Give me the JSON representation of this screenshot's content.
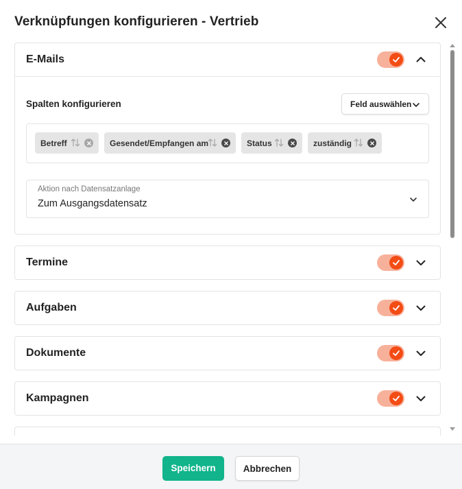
{
  "dialog": {
    "title": "Verknüpfungen konfigurieren - Vertrieb",
    "close_icon": "close-icon"
  },
  "colors": {
    "toggle_track": "#f7b19b",
    "toggle_knob": "#f34c14",
    "primary_button": "#12b48c",
    "footer_bg": "#f4f5f6"
  },
  "sections": [
    {
      "title": "E-Mails",
      "enabled": true,
      "expanded": true,
      "columns_label": "Spalten konfigurieren",
      "field_button_label": "Feld auswählen",
      "chips": [
        {
          "label": "Betreff"
        },
        {
          "label": "Gesendet/Empfangen am"
        },
        {
          "label": "Status"
        },
        {
          "label": "zuständig"
        }
      ],
      "action_label": "Aktion nach Datensatzanlage",
      "action_value": "Zum Ausgangsdatensatz"
    },
    {
      "title": "Termine",
      "enabled": true,
      "expanded": false
    },
    {
      "title": "Aufgaben",
      "enabled": true,
      "expanded": false
    },
    {
      "title": "Dokumente",
      "enabled": true,
      "expanded": false
    },
    {
      "title": "Kampagnen",
      "enabled": true,
      "expanded": false
    }
  ],
  "footer": {
    "save_label": "Speichern",
    "cancel_label": "Abbrechen"
  }
}
